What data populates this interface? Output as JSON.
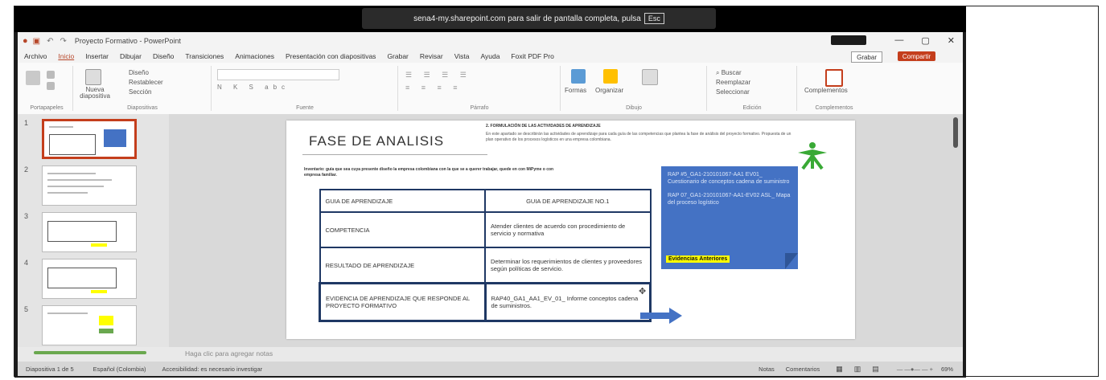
{
  "fullscreen_notice": {
    "text": "sena4-my.sharepoint.com para salir de pantalla completa, pulsa",
    "key": "Esc"
  },
  "titlebar": {
    "document": "Proyecto Formativo - PowerPoint"
  },
  "menu": {
    "tabs": [
      "Archivo",
      "Inicio",
      "Insertar",
      "Dibujar",
      "Diseño",
      "Transiciones",
      "Animaciones",
      "Presentación con diapositivas",
      "Grabar",
      "Revisar",
      "Vista",
      "Ayuda",
      "Foxit PDF Pro"
    ],
    "active_tab": "Inicio",
    "record_label": "Grabar",
    "share_label": "Compartir"
  },
  "ribbon": {
    "groups": [
      "Portapapeles",
      "Diapositivas",
      "Fuente",
      "Párrafo",
      "Dibujo",
      "Edición",
      "Complementos"
    ],
    "new_slide": "Nueva diapositiva",
    "layout": "Diseño",
    "reset": "Restablecer",
    "section": "Sección",
    "shapes": "Formas",
    "arrange": "Organizar",
    "find": "Buscar",
    "replace": "Reemplazar",
    "select": "Seleccionar",
    "addins": "Complementos"
  },
  "thumbnails": [
    "1",
    "2",
    "3",
    "4",
    "5"
  ],
  "slide": {
    "title": "FASE DE ANALISIS",
    "subhead": "2.   FORMULACIÓN DE LAS ACTIVIDADES DE APRENDIZAJE",
    "intro": "En este apartado se describirán las actividades de aprendizaje para cada guía de las competencias que plantea la fase de análisis del proyecto formativo. Propuesta de un plan operativo de los procesos logísticos en una empresa colombiana.",
    "note": "Inventario: guía que sea cuya presente diseño la empresa colombiana con la que se a querer trabajar, quede en con MiPyme o con empresa familiar.",
    "table": [
      [
        "GUIA DE APRENDIZAJE",
        "GUIA DE APRENDIZAJE NO.1"
      ],
      [
        "COMPETENCIA",
        "Atender clientes de acuerdo con procedimiento de servicio y normativa"
      ],
      [
        "RESULTADO DE APRENDIZAJE",
        "Determinar los requerimientos de clientes y proveedores según políticas de servicio."
      ],
      [
        "EVIDENCIA DE APRENDIZAJE QUE RESPONDE AL PROYECTO FORMATIVO",
        "RAP40_GA1_AA1_EV_01_ Informe conceptos cadena de suministros."
      ]
    ],
    "bluebox": [
      "RAP #5_GA1-210101067-AA1 EV01_ Cuestionario de conceptos cadena de suministro",
      "RAP 07_GA1-210101067-AA1-EV02 ASL_ Mapa del proceso logístico"
    ],
    "evidence_label": "Evidencias Anteriores"
  },
  "notes_placeholder": "Haga clic para agregar notas",
  "status": {
    "slide_count": "Diapositiva 1 de 5",
    "language": "Español (Colombia)",
    "accessibility": "Accesibilidad: es necesario investigar",
    "notes": "Notas",
    "comments": "Comentarios",
    "zoom": "69%"
  }
}
